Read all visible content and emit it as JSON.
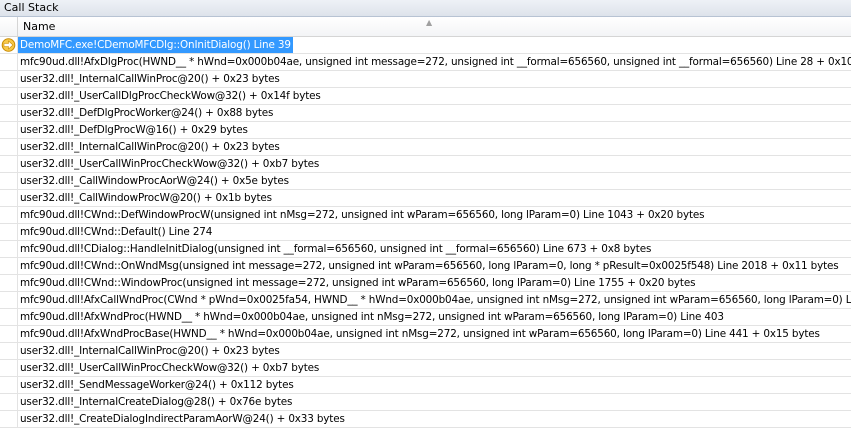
{
  "window": {
    "title": "Call Stack"
  },
  "columns": {
    "name": "Name"
  },
  "icons": {
    "current_frame": "current-statement-arrow-icon"
  },
  "colors": {
    "selection": "#3399ff",
    "arrow_fill": "#f7c948",
    "arrow_stroke": "#c98a00"
  },
  "frames": [
    "DemoMFC.exe!CDemoMFCDlg::OnInitDialog()  Line 39",
    "mfc90ud.dll!AfxDlgProc(HWND__ * hWnd=0x000b04ae, unsigned int message=272, unsigned int __formal=656560, unsigned int __formal=656560)  Line 28 + 0x10 bytes",
    "user32.dll!_InternalCallWinProc@20()  + 0x23 bytes",
    "user32.dll!_UserCallDlgProcCheckWow@32()  + 0x14f bytes",
    "user32.dll!_DefDlgProcWorker@24()  + 0x88 bytes",
    "user32.dll!_DefDlgProcW@16()  + 0x29 bytes",
    "user32.dll!_InternalCallWinProc@20()  + 0x23 bytes",
    "user32.dll!_UserCallWinProcCheckWow@32()  + 0xb7 bytes",
    "user32.dll!_CallWindowProcAorW@24()  + 0x5e bytes",
    "user32.dll!_CallWindowProcW@20()  + 0x1b bytes",
    "mfc90ud.dll!CWnd::DefWindowProcW(unsigned int nMsg=272, unsigned int wParam=656560, long lParam=0)  Line 1043 + 0x20 bytes",
    "mfc90ud.dll!CWnd::Default()  Line 274",
    "mfc90ud.dll!CDialog::HandleInitDialog(unsigned int __formal=656560, unsigned int __formal=656560)  Line 673 + 0x8 bytes",
    "mfc90ud.dll!CWnd::OnWndMsg(unsigned int message=272, unsigned int wParam=656560, long lParam=0, long * pResult=0x0025f548)  Line 2018 + 0x11 bytes",
    "mfc90ud.dll!CWnd::WindowProc(unsigned int message=272, unsigned int wParam=656560, long lParam=0)  Line 1755 + 0x20 bytes",
    "mfc90ud.dll!AfxCallWndProc(CWnd * pWnd=0x0025fa54, HWND__ * hWnd=0x000b04ae, unsigned int nMsg=272, unsigned int wParam=656560, long lParam=0)  Line 240",
    "mfc90ud.dll!AfxWndProc(HWND__ * hWnd=0x000b04ae, unsigned int nMsg=272, unsigned int wParam=656560, long lParam=0)  Line 403",
    "mfc90ud.dll!AfxWndProcBase(HWND__ * hWnd=0x000b04ae, unsigned int nMsg=272, unsigned int wParam=656560, long lParam=0)  Line 441 + 0x15 bytes",
    "user32.dll!_InternalCallWinProc@20()  + 0x23 bytes",
    "user32.dll!_UserCallWinProcCheckWow@32()  + 0xb7 bytes",
    "user32.dll!_SendMessageWorker@24()  + 0x112 bytes",
    "user32.dll!_InternalCreateDialog@28()  + 0x76e bytes",
    "user32.dll!_CreateDialogIndirectParamAorW@24()  + 0x33 bytes"
  ]
}
